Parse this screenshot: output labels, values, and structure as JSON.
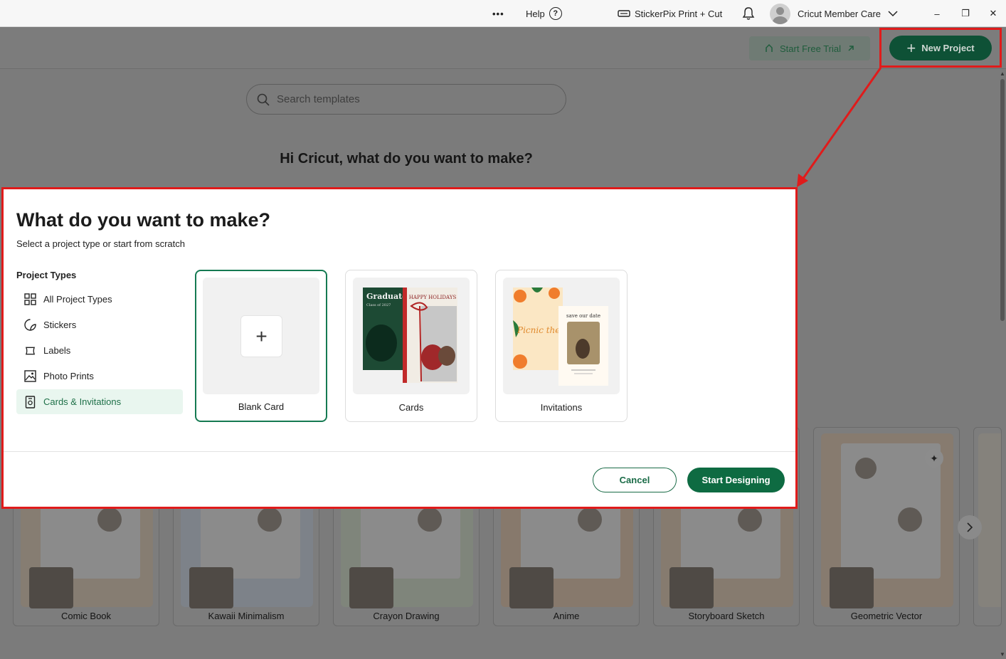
{
  "titlebar": {
    "more_glyph": "•••",
    "help_label": "Help",
    "help_glyph": "?",
    "machine_label": "StickerPix Print + Cut",
    "user_label": "Cricut Member Care",
    "minimize_glyph": "–",
    "maximize_glyph": "❐",
    "close_glyph": "✕"
  },
  "appbar": {
    "trial_label": "Start Free Trial",
    "new_project_label": "New Project"
  },
  "search": {
    "placeholder": "Search templates"
  },
  "greeting": "Hi Cricut, what do you want to make?",
  "styles": [
    {
      "label": "Comic Book"
    },
    {
      "label": "Kawaii Minimalism"
    },
    {
      "label": "Crayon Drawing"
    },
    {
      "label": "Anime"
    },
    {
      "label": "Storyboard Sketch"
    },
    {
      "label": "Geometric Vector"
    }
  ],
  "modal": {
    "title": "What do you want to make?",
    "subtitle": "Select a project type or start from scratch",
    "project_types_heading": "Project Types",
    "project_types": [
      {
        "label": "All Project Types",
        "icon": "grid-icon"
      },
      {
        "label": "Stickers",
        "icon": "sticker-icon"
      },
      {
        "label": "Labels",
        "icon": "label-icon"
      },
      {
        "label": "Photo Prints",
        "icon": "image-icon"
      },
      {
        "label": "Cards & Invitations",
        "icon": "card-icon",
        "active": true
      }
    ],
    "cards": [
      {
        "label": "Blank Card",
        "selected": true
      },
      {
        "label": "Cards",
        "graduate_title": "Graduate",
        "graduate_sub": "Class of 2027",
        "holiday_text": "HAPPY HOLIDAYS"
      },
      {
        "label": "Invitations",
        "save_text": "save our date",
        "picnic_text": "Picnic the Su"
      }
    ],
    "cancel_label": "Cancel",
    "start_label": "Start Designing"
  },
  "colors": {
    "brand_green": "#0e6b42",
    "active_bg": "#e9f6ef",
    "annotation_red": "#e01b1b"
  }
}
